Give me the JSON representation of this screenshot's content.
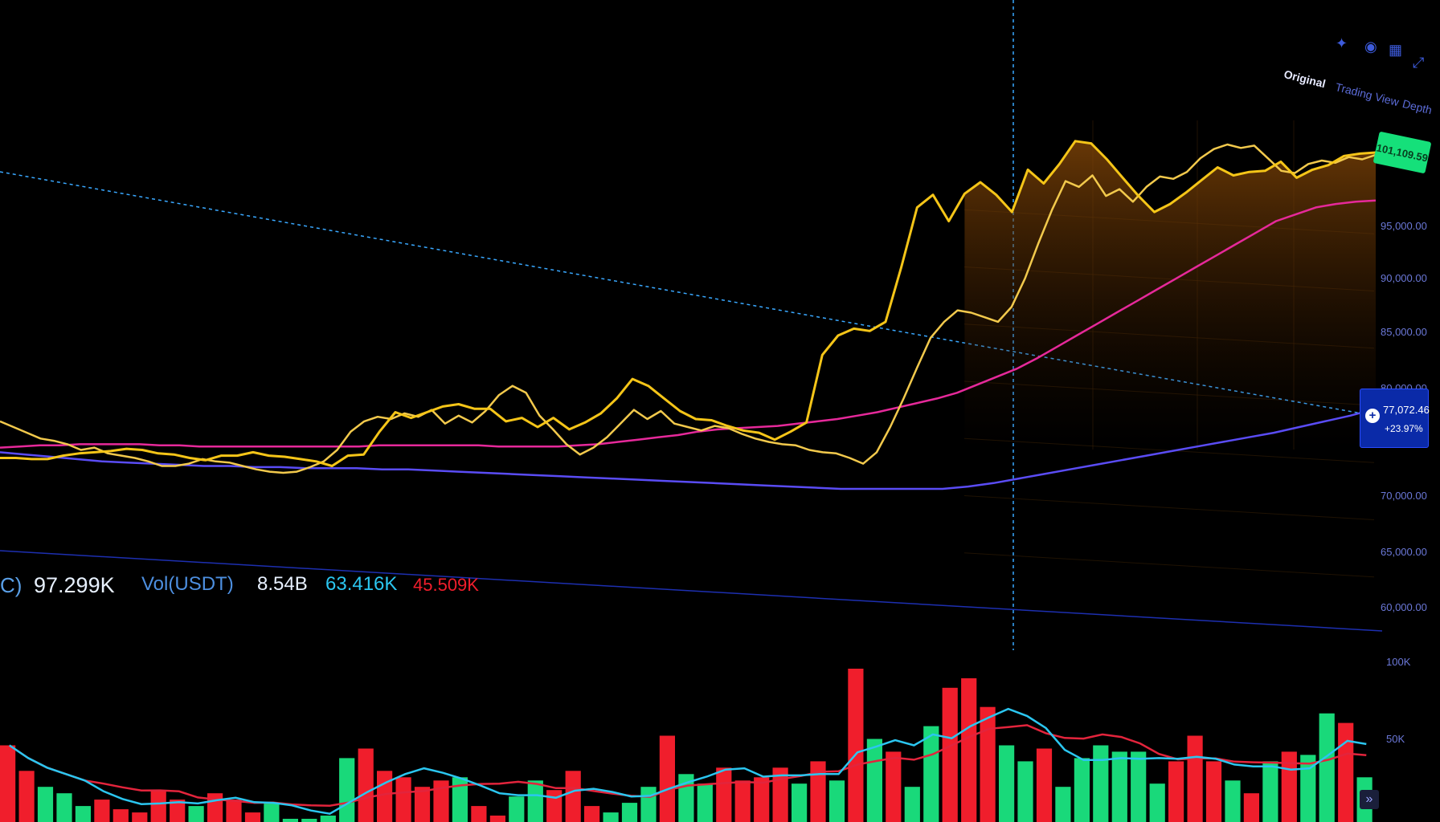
{
  "tabs": [
    {
      "label": "Original",
      "active": true
    },
    {
      "label": "Trading View",
      "active": false
    },
    {
      "label": "Depth",
      "active": false
    }
  ],
  "icons": [
    "magic-wand-icon",
    "bell-icon",
    "grid-icon",
    "expand-icon"
  ],
  "price_axis_ticks": [
    "95,000.00",
    "90,000.00",
    "85,000.00",
    "80,000.00",
    "70,000.00",
    "65,000.00",
    "60,000.00"
  ],
  "last_price_label": "101,109.59",
  "crosshair": {
    "price": "77,072.46",
    "change": "+23.97%"
  },
  "legend": {
    "prefix": "C)",
    "ma_value": "97.299K",
    "vol_label": "Vol(USDT)",
    "vol_value": "8.54B",
    "ma5": "63.416K",
    "ma10": "45.509K"
  },
  "volume_axis_ticks": [
    "100K",
    "50K"
  ],
  "colors": {
    "price": "#f5c518",
    "ma_fast": "#f2c94c",
    "ma_mid": "#e6299a",
    "ma_slow": "#5a4cf5",
    "up": "#19d97a",
    "down": "#f01e2c",
    "vol_ma_cyan": "#2bc6f0",
    "vol_ma_red": "#e3243c",
    "accent": "#2a4cff"
  },
  "chart_data": [
    {
      "type": "line",
      "series": [
        {
          "values": [
            76500,
            76000,
            75500,
            75000,
            74800,
            74500,
            74000,
            74200,
            73700,
            73500,
            73300,
            73000,
            72600,
            72600,
            72800,
            73200,
            73000,
            72900,
            72600,
            72300,
            72100,
            72000,
            72100,
            72500,
            73000,
            74000,
            75600,
            76500,
            76900,
            76700,
            77200,
            76900,
            77500,
            76300,
            77000,
            76400,
            77400,
            78800,
            79600,
            79000,
            77000,
            75800,
            74500,
            73600,
            74200,
            75100,
            76300,
            77500,
            76700,
            77400,
            76300,
            76000,
            75700,
            76100,
            75900,
            75400,
            75000,
            74700,
            74500,
            74400,
            74000,
            73800,
            73700,
            73300,
            72800,
            73800,
            76000,
            78500,
            81200,
            83800,
            85200,
            86200,
            86000,
            85600,
            85200,
            86500,
            89000,
            92100,
            95000,
            97500,
            97000,
            98000,
            96200,
            96800,
            95700,
            97000,
            97900,
            97700,
            98300,
            99500,
            100300,
            100700,
            100400,
            100600,
            99500,
            98400,
            98200,
            99000,
            99300,
            99100,
            99600,
            99400,
            99800
          ]
        },
        {
          "values": [
            73300,
            73300,
            73200,
            73200,
            73500,
            73700,
            73800,
            73900,
            74100,
            74000,
            73700,
            73600,
            73300,
            73100,
            73500,
            73500,
            73800,
            73500,
            73400,
            73200,
            73000,
            72600,
            73500,
            73600,
            75600,
            77300,
            76800,
            77300,
            77800,
            78000,
            77600,
            77600,
            76500,
            76800,
            76000,
            76800,
            75800,
            76400,
            77200,
            78500,
            80200,
            79600,
            78500,
            77400,
            76700,
            76600,
            76100,
            75700,
            75500,
            74900,
            75600,
            76400,
            82300,
            84000,
            84600,
            84400,
            85200,
            90000,
            95200,
            96300,
            94000,
            96400,
            97400,
            96300,
            94800,
            98500,
            97300,
            99000,
            101000,
            100800,
            99400,
            97800,
            96200,
            94800,
            95500,
            96500,
            97600,
            98700,
            98000,
            98300,
            98400,
            99200,
            97800,
            98500,
            98900,
            99700,
            99900,
            100000
          ]
        },
        {
          "values": [
            74200,
            74300,
            74400,
            74400,
            74500,
            74500,
            74500,
            74500,
            74400,
            74400,
            74300,
            74300,
            74300,
            74300,
            74300,
            74300,
            74300,
            74300,
            74300,
            74400,
            74400,
            74400,
            74400,
            74400,
            74400,
            74300,
            74300,
            74300,
            74300,
            74400,
            74500,
            74700,
            74900,
            75100,
            75300,
            75600,
            75800,
            75900,
            76000,
            76100,
            76300,
            76500,
            76700,
            77000,
            77300,
            77700,
            78100,
            78500,
            79000,
            79700,
            80400,
            81100,
            82000,
            83000,
            84000,
            85000,
            86000,
            87000,
            88000,
            89000,
            90000,
            91000,
            92000,
            93000,
            94000,
            94600,
            95200,
            95500,
            95700,
            95800
          ]
        },
        {
          "values": [
            73800,
            73600,
            73400,
            73200,
            73000,
            72900,
            72800,
            72700,
            72600,
            72600,
            72500,
            72500,
            72400,
            72400,
            72400,
            72300,
            72300,
            72200,
            72100,
            72000,
            71900,
            71800,
            71700,
            71600,
            71500,
            71400,
            71300,
            71200,
            71100,
            71000,
            70900,
            70800,
            70700,
            70600,
            70600,
            70600,
            70600,
            70600,
            70800,
            71100,
            71500,
            71900,
            72300,
            72700,
            73100,
            73500,
            73900,
            74300,
            74700,
            75100,
            75500,
            76000,
            76500,
            77000,
            77600
          ]
        }
      ]
    },
    {
      "type": "bar",
      "series": [
        {
          "values": [
            48,
            32,
            22,
            18,
            10,
            14,
            8,
            6,
            20,
            14,
            10,
            18,
            14,
            6,
            12,
            2,
            2,
            4,
            40,
            46,
            32,
            28,
            22,
            26,
            28,
            10,
            4,
            16,
            26,
            20,
            32,
            10,
            6,
            12,
            22,
            54,
            30,
            24,
            34,
            26,
            28,
            34,
            24,
            38,
            26,
            96,
            52,
            44,
            22,
            60,
            84,
            90,
            72,
            48,
            38,
            46,
            22,
            40,
            48,
            44,
            44,
            24,
            38,
            54,
            38,
            26,
            18,
            38,
            44,
            42,
            68,
            62,
            28
          ]
        }
      ]
    }
  ]
}
